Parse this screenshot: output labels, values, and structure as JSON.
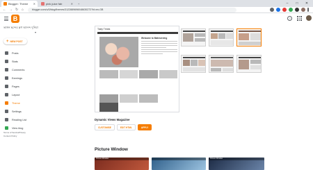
{
  "browser": {
    "tabs": [
      {
        "title": "Blogger: Theme",
        "active": true
      },
      {
        "title": "pink juice fab",
        "active": false
      }
    ],
    "url": "blogger.com/u/0/blog/themes/3122889696048630272?hl=en-GB",
    "window_controls": [
      "–",
      "□",
      "✕"
    ]
  },
  "header": {
    "logo_letter": "B"
  },
  "sidebar": {
    "blog_title": "ভাঙ্গন ছন্দের ব্লগ আনন্দ দুনিয়া",
    "new_post_label": "NEW POST",
    "items": [
      {
        "label": "Posts",
        "icon": "posts-icon",
        "active": false
      },
      {
        "label": "Stats",
        "icon": "stats-icon",
        "active": false
      },
      {
        "label": "Comments",
        "icon": "comments-icon",
        "active": false
      },
      {
        "label": "Earnings",
        "icon": "earnings-icon",
        "active": false
      },
      {
        "label": "Pages",
        "icon": "pages-icon",
        "active": false
      },
      {
        "label": "Layout",
        "icon": "layout-icon",
        "active": false
      },
      {
        "label": "Theme",
        "icon": "theme-icon",
        "active": true
      },
      {
        "label": "Settings",
        "icon": "settings-icon",
        "active": false
      },
      {
        "label": "Reading List",
        "icon": "reading-list-icon",
        "active": false
      },
      {
        "label": "View blog",
        "icon": "view-blog-icon",
        "active": false
      }
    ],
    "footer": {
      "terms": "Terms of Service",
      "privacy": "Privacy",
      "content_policy": "Content Policy"
    }
  },
  "main": {
    "preview": {
      "blog_name": "Tasty Treats",
      "post_title": "Welcome to Mateserving"
    },
    "current_theme": {
      "name": "Dynamic Views Magazine",
      "buttons": {
        "customize": "CUSTOMISE",
        "edit_html": "EDIT HTML",
        "apply": "APPLY"
      }
    },
    "next_section": {
      "title": "Picture Window",
      "thumb_labels": [
        "Picture Window",
        "",
        "Picture Window"
      ]
    }
  },
  "colors": {
    "accent": "#f57d00",
    "tab_bar": "#dee1e6"
  }
}
